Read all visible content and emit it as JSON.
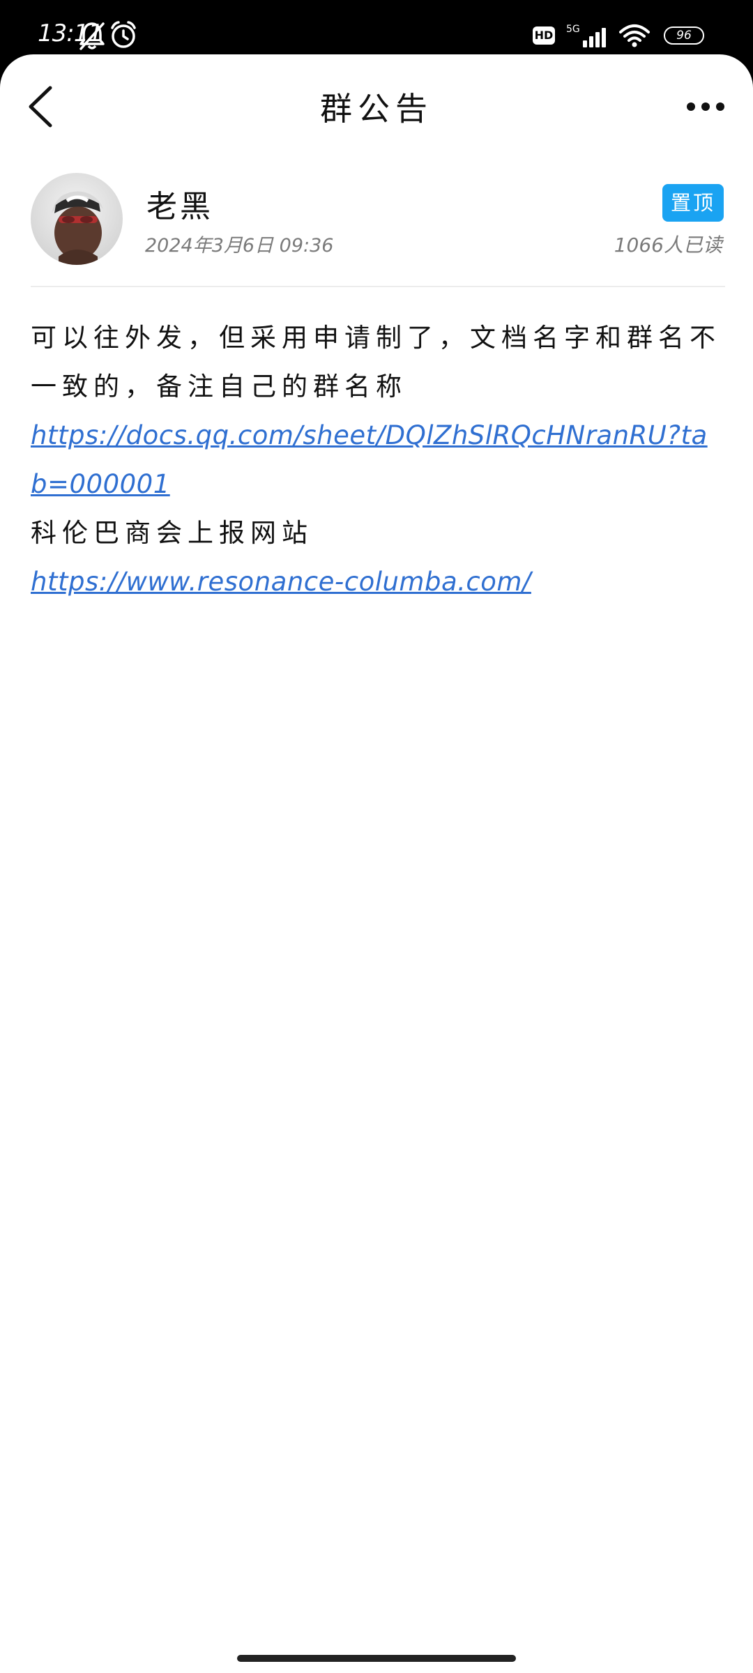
{
  "status_bar": {
    "time": "13:11",
    "hd_label": "HD",
    "network_label": "5G",
    "battery": "96",
    "icons": [
      "mute-bell-icon",
      "alarm-clock-icon",
      "signal-icon",
      "wifi-icon",
      "battery-icon"
    ]
  },
  "nav": {
    "title": "群公告",
    "back_icon": "chevron-left-icon",
    "more_icon": "more-dots-icon"
  },
  "post": {
    "author": "老黑",
    "timestamp": "2024年3月6日  09:36",
    "pin_label": "置顶",
    "read_count": "1066人已读",
    "paragraphs": {
      "text1": "可以往外发，但采用申请制了，文档名字和群名不一致的，备注自己的群名称",
      "link1": "https://docs.qq.com/sheet/DQlZhSlRQcHNranRU?tab=000001",
      "text2": "科伦巴商会上报网站",
      "link2": "https://www.resonance-columba.com/"
    }
  },
  "colors": {
    "accent": "#1aa3f2",
    "link": "#2f6fd1",
    "secondary_text": "#7a7a7a",
    "primary_text": "#111111"
  }
}
